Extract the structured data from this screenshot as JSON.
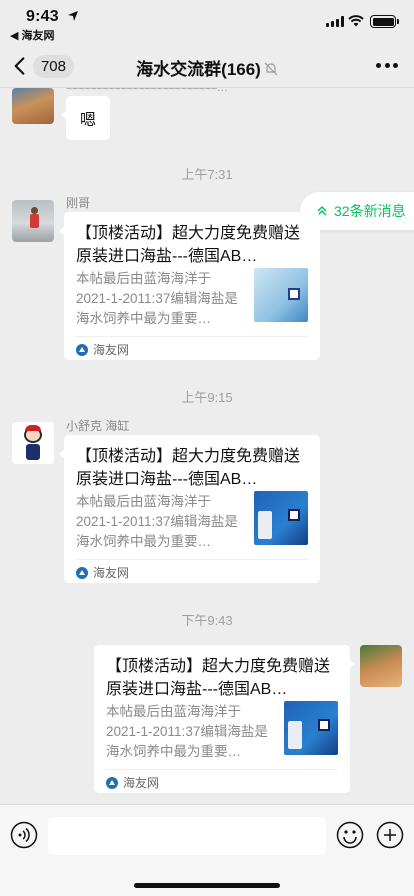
{
  "status_bar": {
    "time": "9:43",
    "back_app": "◀ 海友网"
  },
  "nav": {
    "back_count": "708",
    "title": "海水交流群(166)"
  },
  "chat": {
    "top_truncated": "≈≈≈≈≈≈≈≈≈≈≈≈≈≈≈≈≈≈≈≈≈≈≈≈≈…",
    "first_message": "嗯",
    "new_messages": "32条新消息",
    "groups": [
      {
        "time": "上午7:31",
        "sender": "刚哥",
        "title": "【顶楼活动】超大力度免费赠送原装进口海盐---德国AB…",
        "desc": "本帖最后由蓝海海洋于2021-1-2011:37编辑海盐是海水饲养中最为重要…",
        "source": "海友网"
      },
      {
        "time": "上午9:15",
        "sender": "小舒克 海缸",
        "title": "【顶楼活动】超大力度免费赠送原装进口海盐---德国AB…",
        "desc": "本帖最后由蓝海海洋于2021-1-2011:37编辑海盐是海水饲养中最为重要…",
        "source": "海友网"
      },
      {
        "time": "下午9:43",
        "sender": "",
        "title": "【顶楼活动】超大力度免费赠送原装进口海盐---德国AB…",
        "desc": "本帖最后由蓝海海洋于2021-1-2011:37编辑海盐是海水饲养中最为重要…",
        "source": "海友网"
      }
    ]
  },
  "input": {
    "placeholder": ""
  },
  "colors": {
    "accent_green": "#07c160",
    "background": "#ededed"
  }
}
